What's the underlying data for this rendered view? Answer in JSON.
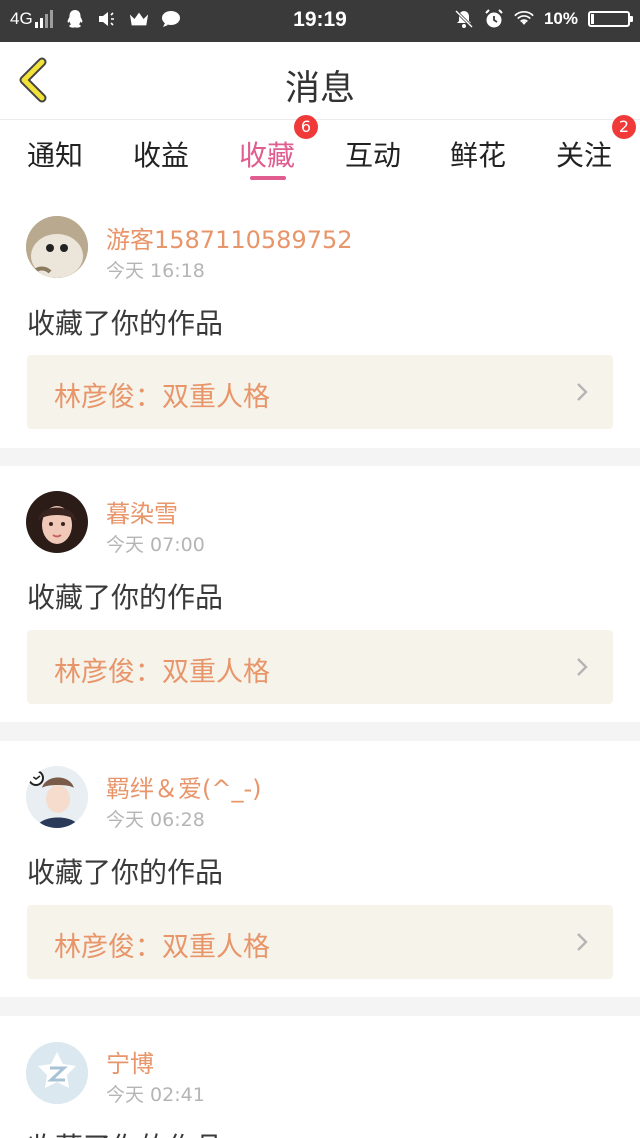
{
  "status_bar": {
    "network": "4G",
    "time": "19:19",
    "battery": "10%"
  },
  "header": {
    "title": "消息"
  },
  "tabs": [
    {
      "label": "通知"
    },
    {
      "label": "收益"
    },
    {
      "label": "收藏",
      "badge": "6",
      "active": true
    },
    {
      "label": "互动"
    },
    {
      "label": "鲜花"
    },
    {
      "label": "关注",
      "badge": "2"
    }
  ],
  "messages": [
    {
      "user": "游客1587110589752",
      "time": "今天 16:18",
      "action": "收藏了你的作品",
      "work": "林彦俊：双重人格"
    },
    {
      "user": "暮染雪",
      "time": "今天 07:00",
      "action": "收藏了你的作品",
      "work": "林彦俊：双重人格"
    },
    {
      "user": "羁绊＆爱(^_-)",
      "time": "今天 06:28",
      "action": "收藏了你的作品",
      "work": "林彦俊：双重人格"
    },
    {
      "user": "宁博",
      "time": "今天 02:41",
      "action": "收藏了你的作品"
    }
  ],
  "colors": {
    "accent_pink": "#e15c8f",
    "username_orange": "#e8956a",
    "badge_red": "#f03a3a",
    "work_bg": "#f5f3ea"
  }
}
